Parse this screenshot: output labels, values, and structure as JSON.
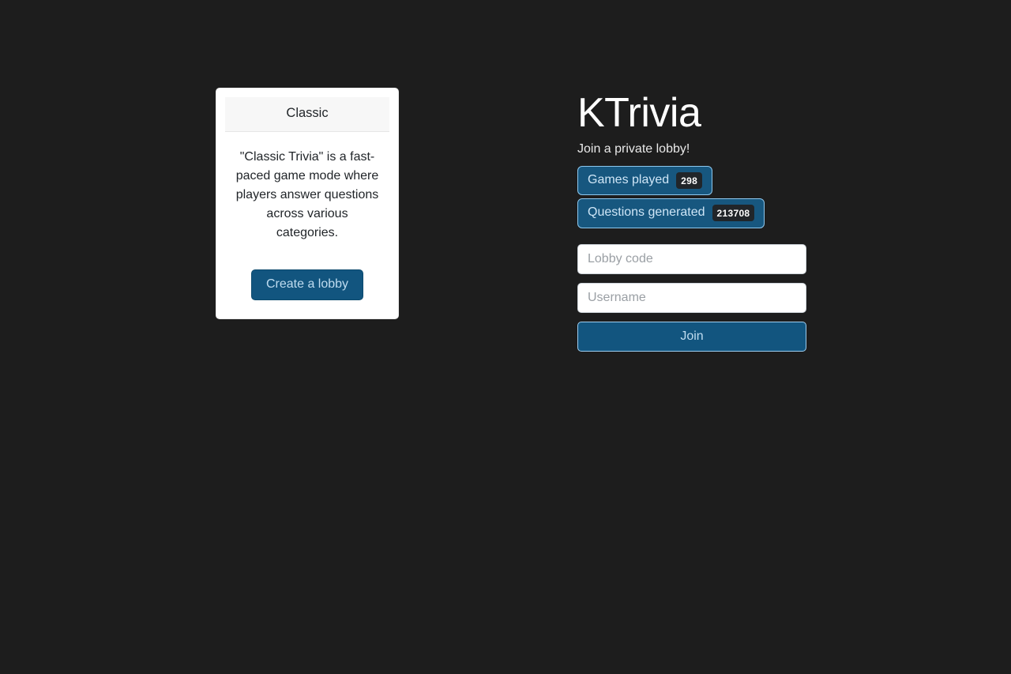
{
  "theme": {
    "background": "#1d1d1d",
    "card_background": "#ffffff",
    "accent_blue": "#12557f",
    "accent_blue_light": "#9ecdf0",
    "badge_count_background": "#212529"
  },
  "mode_card": {
    "header_title": "Classic",
    "description": "\"Classic Trivia\" is a fast-paced game mode where players answer questions across various categories.",
    "create_button_label": "Create a lobby"
  },
  "join_panel": {
    "app_title": "KTrivia",
    "subtitle": "Join a private lobby!",
    "stats": [
      {
        "label": "Games played",
        "count": "298"
      },
      {
        "label": "Questions generated",
        "count": "213708"
      }
    ],
    "lobby_code": {
      "value": "",
      "placeholder": "Lobby code"
    },
    "username": {
      "value": "",
      "placeholder": "Username"
    },
    "join_button_label": "Join"
  }
}
